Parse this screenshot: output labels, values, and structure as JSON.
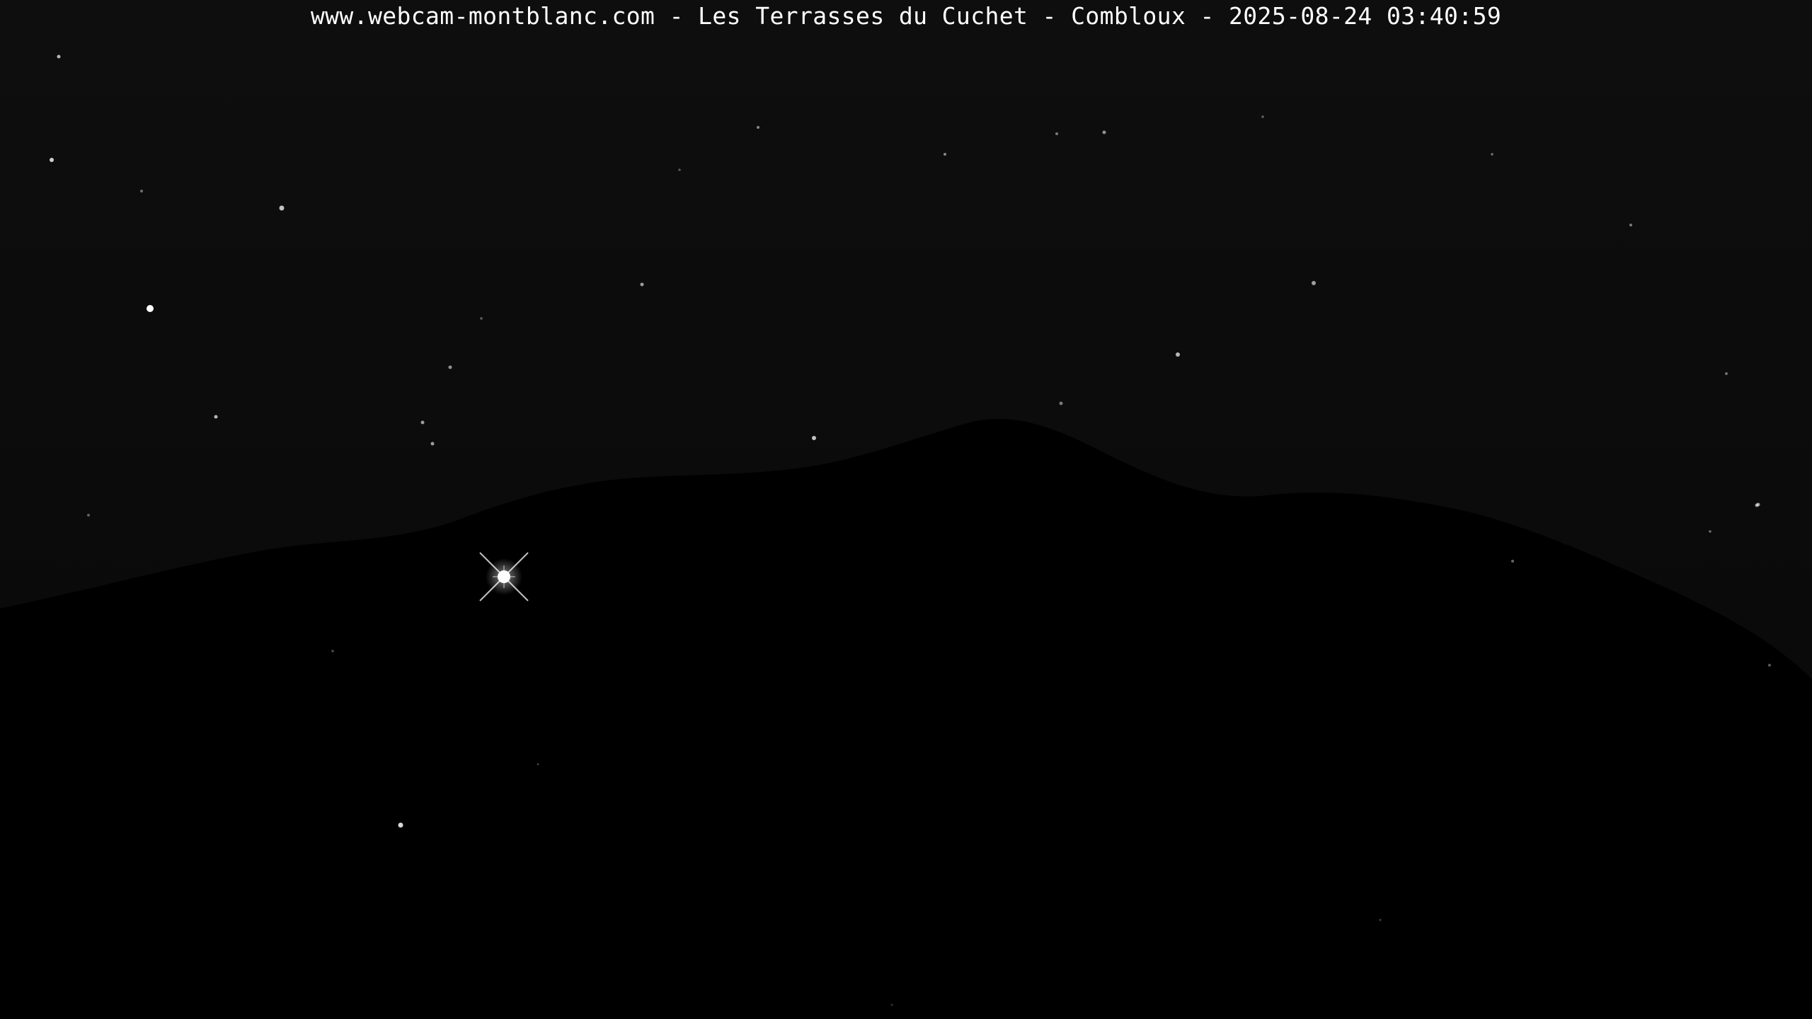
{
  "caption": {
    "text": "www.webcam-montblanc.com - Les Terrasses du Cuchet - Combloux - 2025-08-24 03:40:59"
  },
  "scene": {
    "subject": "night sky with stars above dark mountain ridge",
    "colors": {
      "background": "#000000",
      "sky_glow": "#0d0d0d",
      "star": "#ffffff",
      "caption_text": "#ffffff"
    }
  }
}
